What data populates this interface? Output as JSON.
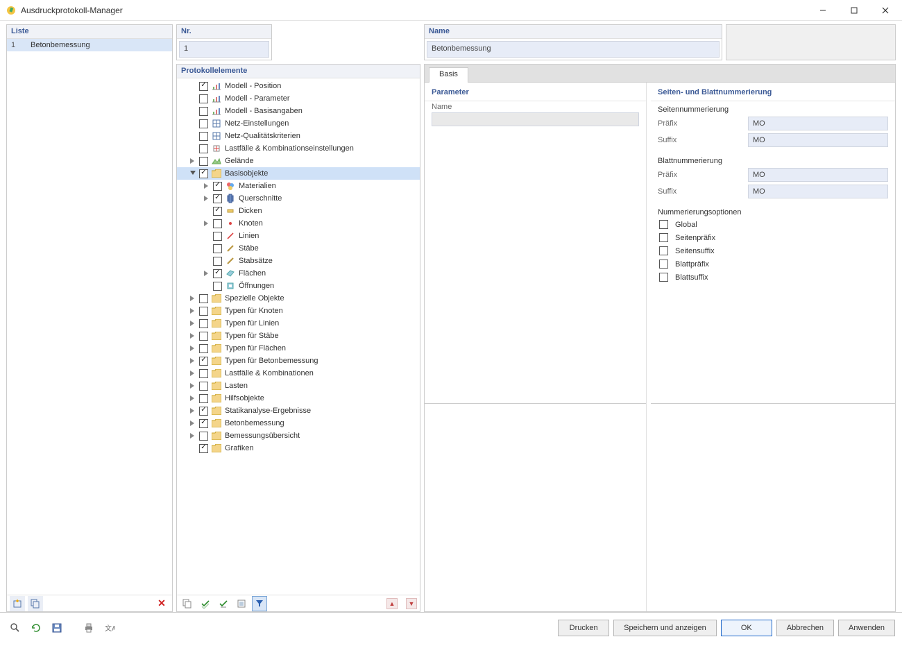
{
  "window": {
    "title": "Ausdruckprotokoll-Manager"
  },
  "liste": {
    "header": "Liste",
    "rows": [
      {
        "n": "1",
        "t": "Betonbemessung",
        "selected": true
      }
    ]
  },
  "mid": {
    "nr_header": "Nr.",
    "nr_value": "1",
    "protokoll_header": "Protokollelemente"
  },
  "right": {
    "name_header": "Name",
    "name_value": "Betonbemessung",
    "tab_basis": "Basis",
    "param_header": "Parameter",
    "param_name_label": "Name",
    "param_name_value": "",
    "num_header": "Seiten- und Blattnummerierung",
    "seiten_heading": "Seitennummerierung",
    "praefix_label": "Präfix",
    "suffix_label": "Suffix",
    "blatt_heading": "Blattnummerierung",
    "opts_heading": "Nummerierungsoptionen",
    "seiten_praefix": "MO",
    "seiten_suffix": "MO",
    "blatt_praefix": "MO",
    "blatt_suffix": "MO",
    "opts": {
      "global": "Global",
      "seitenpraefix": "Seitenpräfix",
      "seitensuffix": "Seitensuffix",
      "blattpraefix": "Blattpräfix",
      "blattsuffix": "Blattsuffix"
    }
  },
  "tree": [
    {
      "depth": 0,
      "exp": "none",
      "checked": true,
      "icon": "chart",
      "label": "Modell - Position"
    },
    {
      "depth": 0,
      "exp": "none",
      "checked": false,
      "icon": "chart",
      "label": "Modell - Parameter"
    },
    {
      "depth": 0,
      "exp": "none",
      "checked": false,
      "icon": "chart",
      "label": "Modell - Basisangaben"
    },
    {
      "depth": 0,
      "exp": "none",
      "checked": false,
      "icon": "mesh",
      "label": "Netz-Einstellungen"
    },
    {
      "depth": 0,
      "exp": "none",
      "checked": false,
      "icon": "mesh",
      "label": "Netz-Qualitätskriterien"
    },
    {
      "depth": 0,
      "exp": "none",
      "checked": false,
      "icon": "load",
      "label": "Lastfälle & Kombinationseinstellungen"
    },
    {
      "depth": 0,
      "exp": "closed",
      "checked": false,
      "icon": "terrain",
      "label": "Gelände"
    },
    {
      "depth": 0,
      "exp": "open",
      "checked": true,
      "icon": "folder",
      "label": "Basisobjekte",
      "selected": true
    },
    {
      "depth": 1,
      "exp": "closed",
      "checked": true,
      "icon": "mat",
      "label": "Materialien"
    },
    {
      "depth": 1,
      "exp": "closed",
      "checked": true,
      "icon": "cross",
      "label": "Querschnitte"
    },
    {
      "depth": 1,
      "exp": "none",
      "checked": true,
      "icon": "thick",
      "label": "Dicken"
    },
    {
      "depth": 1,
      "exp": "closed",
      "checked": false,
      "icon": "node",
      "label": "Knoten"
    },
    {
      "depth": 1,
      "exp": "none",
      "checked": false,
      "icon": "line",
      "label": "Linien"
    },
    {
      "depth": 1,
      "exp": "none",
      "checked": false,
      "icon": "member",
      "label": "Stäbe"
    },
    {
      "depth": 1,
      "exp": "none",
      "checked": false,
      "icon": "member",
      "label": "Stabsätze"
    },
    {
      "depth": 1,
      "exp": "closed",
      "checked": true,
      "icon": "surf",
      "label": "Flächen"
    },
    {
      "depth": 1,
      "exp": "none",
      "checked": false,
      "icon": "open",
      "label": "Öffnungen"
    },
    {
      "depth": 0,
      "exp": "closed",
      "checked": false,
      "icon": "folder",
      "label": "Spezielle Objekte"
    },
    {
      "depth": 0,
      "exp": "closed",
      "checked": false,
      "icon": "folder",
      "label": "Typen für Knoten"
    },
    {
      "depth": 0,
      "exp": "closed",
      "checked": false,
      "icon": "folder",
      "label": "Typen für Linien"
    },
    {
      "depth": 0,
      "exp": "closed",
      "checked": false,
      "icon": "folder",
      "label": "Typen für Stäbe"
    },
    {
      "depth": 0,
      "exp": "closed",
      "checked": false,
      "icon": "folder",
      "label": "Typen für Flächen"
    },
    {
      "depth": 0,
      "exp": "closed",
      "checked": true,
      "icon": "folder",
      "label": "Typen für Betonbemessung"
    },
    {
      "depth": 0,
      "exp": "closed",
      "checked": false,
      "icon": "folder",
      "label": "Lastfälle & Kombinationen"
    },
    {
      "depth": 0,
      "exp": "closed",
      "checked": false,
      "icon": "folder",
      "label": "Lasten"
    },
    {
      "depth": 0,
      "exp": "closed",
      "checked": false,
      "icon": "folder",
      "label": "Hilfsobjekte"
    },
    {
      "depth": 0,
      "exp": "closed",
      "checked": true,
      "icon": "folder",
      "label": "Statikanalyse-Ergebnisse"
    },
    {
      "depth": 0,
      "exp": "closed",
      "checked": true,
      "icon": "folder",
      "label": "Betonbemessung"
    },
    {
      "depth": 0,
      "exp": "closed",
      "checked": false,
      "icon": "folder",
      "label": "Bemessungsübersicht"
    },
    {
      "depth": 0,
      "exp": "none",
      "checked": true,
      "icon": "folder",
      "label": "Grafiken"
    }
  ],
  "buttons": {
    "drucken": "Drucken",
    "speichern": "Speichern und anzeigen",
    "ok": "OK",
    "abbrechen": "Abbrechen",
    "anwenden": "Anwenden"
  }
}
